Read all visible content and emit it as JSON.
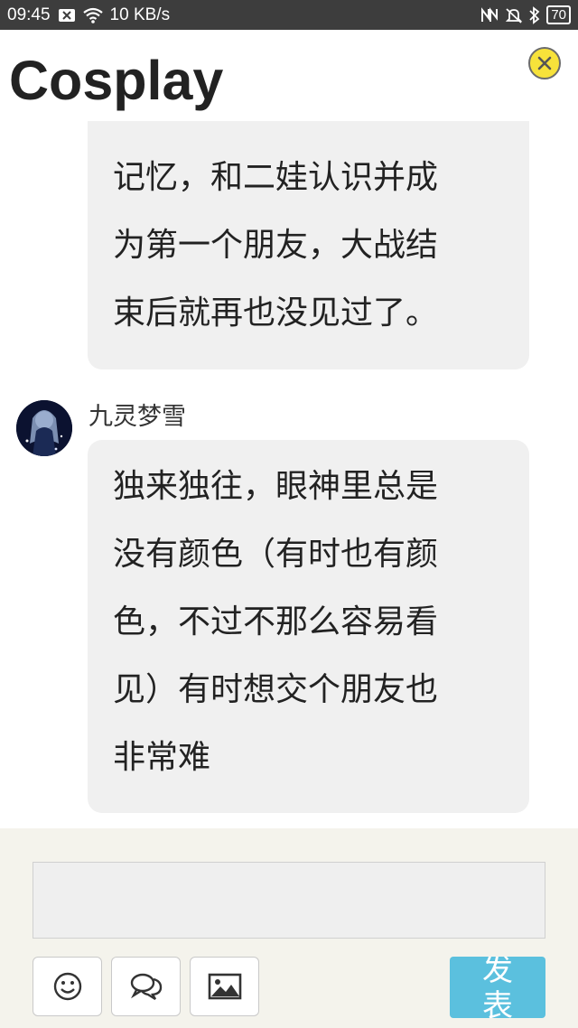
{
  "status_bar": {
    "time": "09:45",
    "speed": "10 KB/s",
    "battery": "70"
  },
  "header": {
    "title": "Cosplay"
  },
  "messages": [
    {
      "lines": [
        "… … …",
        "记忆，和二娃认识并成",
        "为第一个朋友，大战结",
        "束后就再也没见过了。"
      ]
    },
    {
      "username": "九灵梦雪",
      "lines": [
        "独来独往，眼神里总是",
        "没有颜色（有时也有颜",
        "色，不过不那么容易看",
        "见）有时想交个朋友也",
        "非常难"
      ]
    }
  ],
  "footer": {
    "input_value": "",
    "send_label_line1": "发",
    "send_label_line2": "表"
  },
  "colors": {
    "accent_send": "#5bc0de",
    "close_button": "#f7e23a",
    "bubble_bg": "#f0f0f0",
    "footer_bg": "#f4f3ec"
  }
}
